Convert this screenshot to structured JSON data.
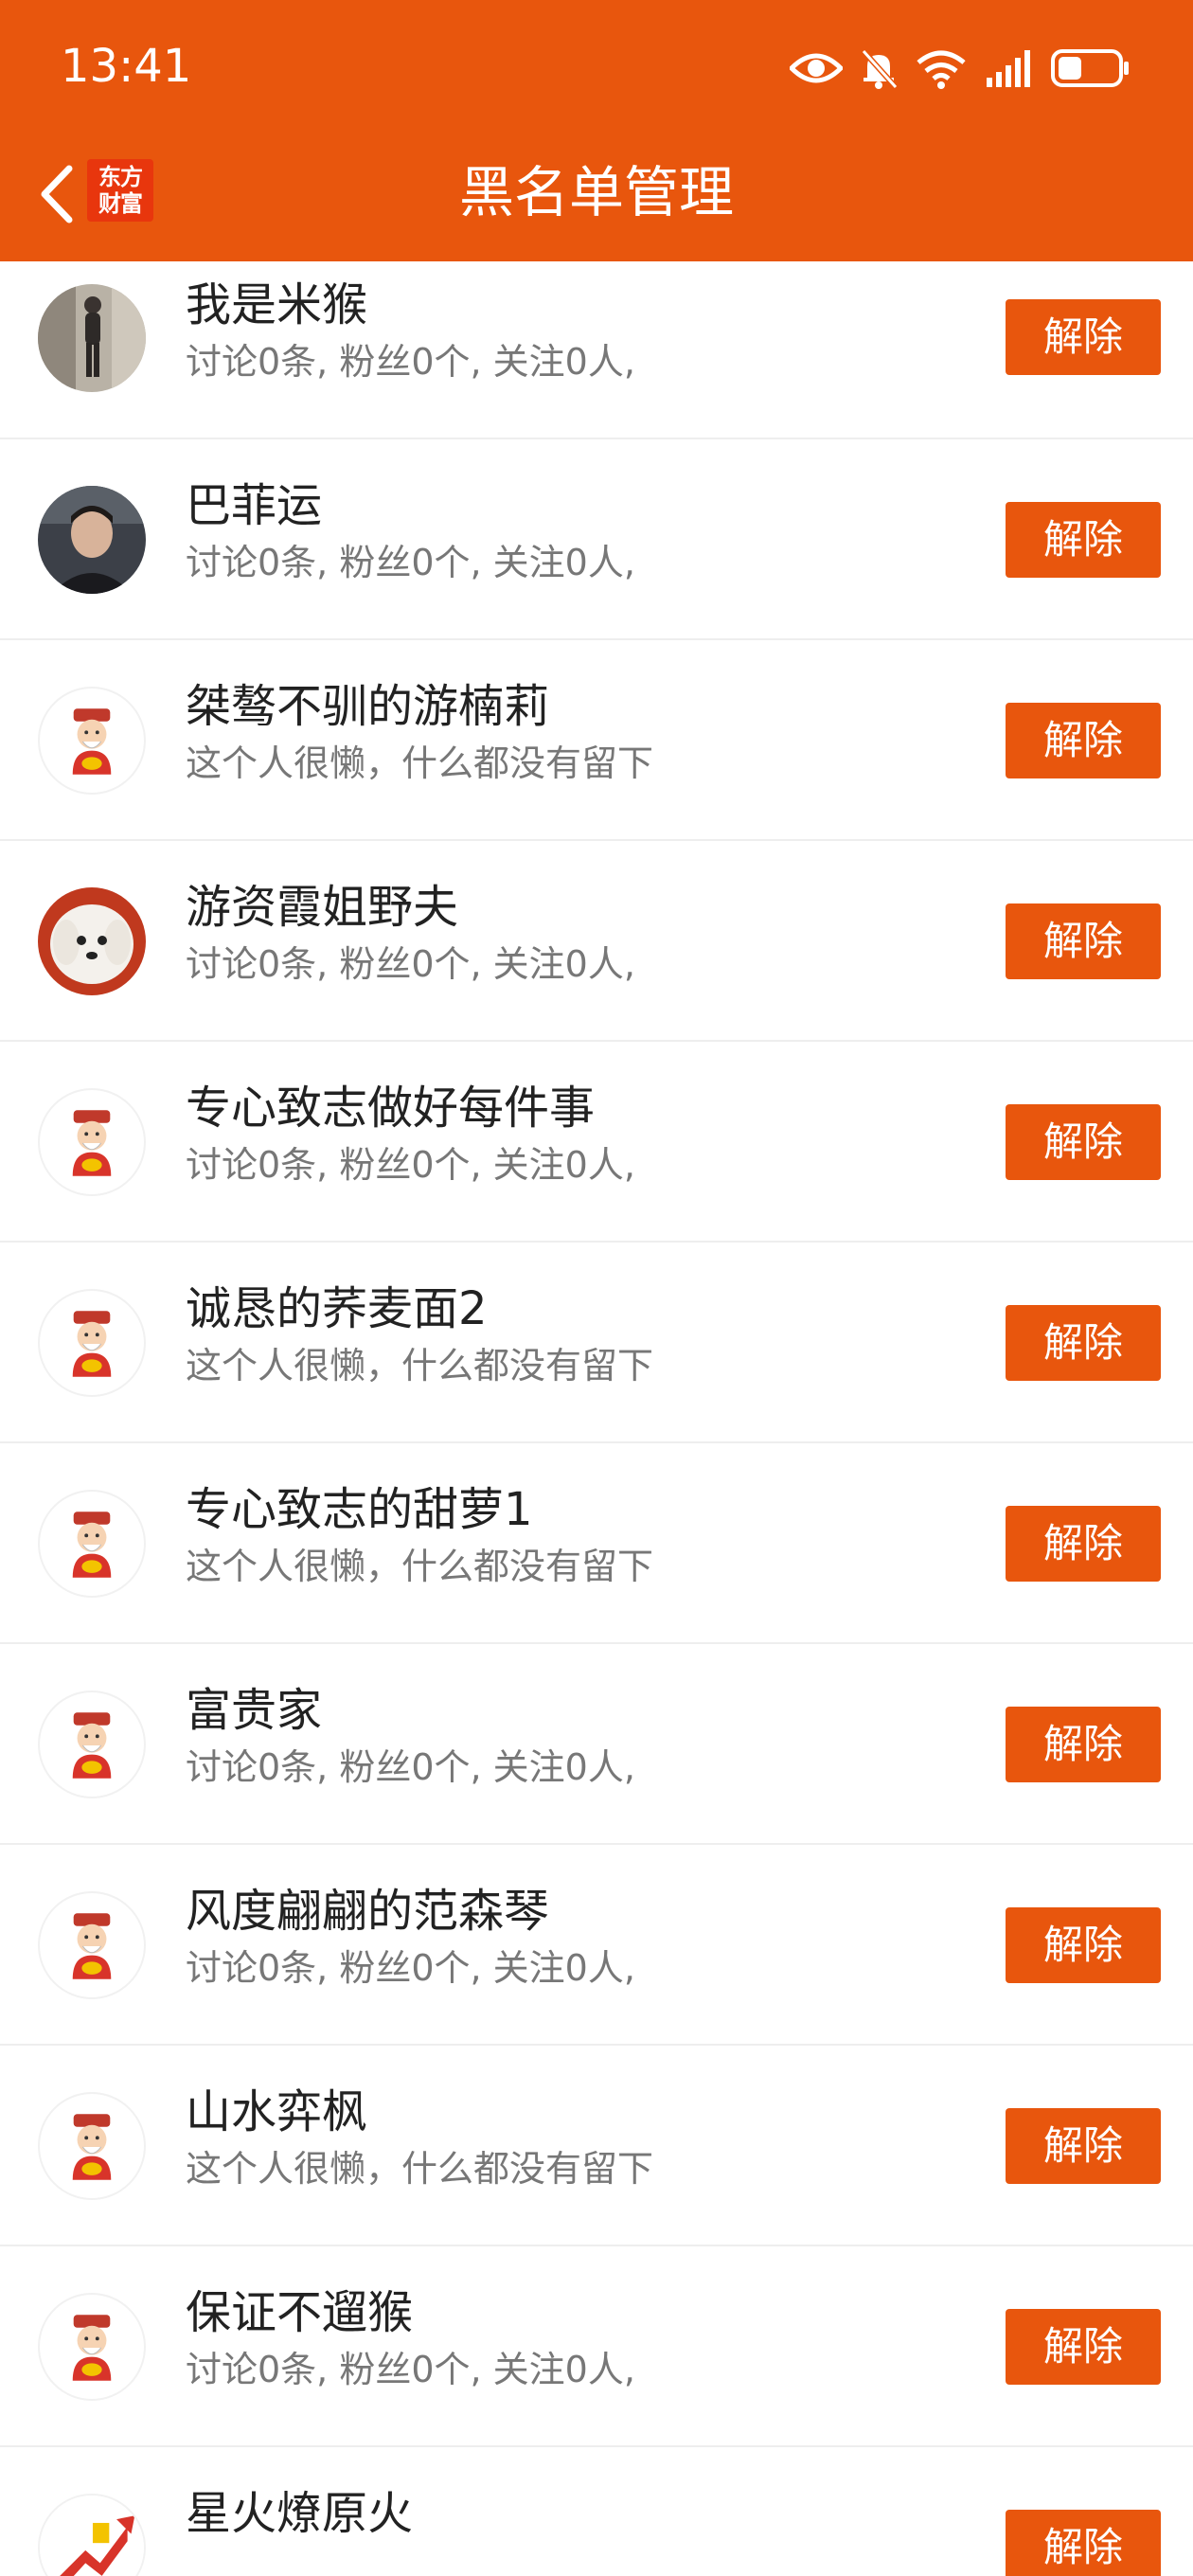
{
  "status_bar": {
    "time": "13:41",
    "icons": [
      "eye-icon",
      "bell-muted-icon",
      "wifi-6-icon",
      "signal-icon",
      "battery-icon"
    ]
  },
  "nav": {
    "back_icon": "chevron-left-icon",
    "logo_line1": "东方",
    "logo_line2": "财富",
    "title": "黑名单管理"
  },
  "colors": {
    "accent": "#e8560d",
    "logo_red": "#e8360d",
    "text_primary": "#222222",
    "text_secondary": "#777777"
  },
  "rows": [
    {
      "name": "我是米猴",
      "subtitle": "讨论0条, 粉丝0个, 关注0人,",
      "button": "解除",
      "avatar": "photo-person-standing"
    },
    {
      "name": "巴菲运",
      "subtitle": "讨论0条, 粉丝0个, 关注0人,",
      "button": "解除",
      "avatar": "photo-man-portrait"
    },
    {
      "name": "桀骜不驯的游楠莉",
      "subtitle": "这个人很懒，什么都没有留下",
      "button": "解除",
      "avatar": "fortune-god-avatar"
    },
    {
      "name": "游资霞姐野夫",
      "subtitle": "讨论0条, 粉丝0个, 关注0人,",
      "button": "解除",
      "avatar": "photo-white-dog"
    },
    {
      "name": "专心致志做好每件事",
      "subtitle": "讨论0条, 粉丝0个, 关注0人,",
      "button": "解除",
      "avatar": "fortune-god-avatar"
    },
    {
      "name": "诚恳的荞麦面2",
      "subtitle": "这个人很懒，什么都没有留下",
      "button": "解除",
      "avatar": "fortune-god-avatar"
    },
    {
      "name": "专心致志的甜萝1",
      "subtitle": "这个人很懒，什么都没有留下",
      "button": "解除",
      "avatar": "fortune-god-avatar"
    },
    {
      "name": "富贵家",
      "subtitle": "讨论0条, 粉丝0个, 关注0人,",
      "button": "解除",
      "avatar": "fortune-god-avatar"
    },
    {
      "name": "风度翩翩的范森琴",
      "subtitle": "讨论0条, 粉丝0个, 关注0人,",
      "button": "解除",
      "avatar": "fortune-god-avatar"
    },
    {
      "name": "山水弈枫",
      "subtitle": "这个人很懒，什么都没有留下",
      "button": "解除",
      "avatar": "fortune-god-avatar"
    },
    {
      "name": "保证不遛猴",
      "subtitle": "讨论0条, 粉丝0个, 关注0人,",
      "button": "解除",
      "avatar": "fortune-god-avatar"
    },
    {
      "name": "星火燎原火",
      "subtitle": "",
      "button": "解除",
      "avatar": "photo-chart-arrow"
    }
  ]
}
